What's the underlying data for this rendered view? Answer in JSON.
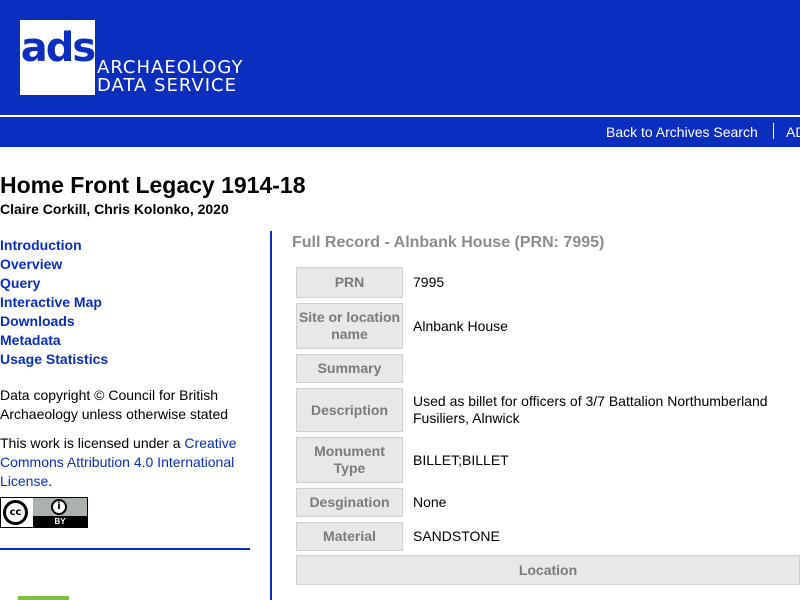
{
  "header": {
    "logo_letters": "ads",
    "logo_line1": "ARCHAEOLOGY",
    "logo_line2": "DATA SERVICE",
    "nav": {
      "back_link": "Back to Archives Search",
      "ads_link": "AD"
    }
  },
  "page": {
    "title": "Home Front Legacy 1914-18",
    "authors": "Claire Corkill, Chris Kolonko, 2020"
  },
  "sidebar": {
    "links": [
      "Introduction",
      "Overview",
      "Query",
      "Interactive Map",
      "Downloads",
      "Metadata",
      "Usage Statistics"
    ],
    "copyright": "Data copyright © Council for British Archaeology unless otherwise stated",
    "license_prefix": "This work is licensed under a ",
    "license_link": "Creative Commons Attribution 4.0 International License",
    "license_suffix": ".",
    "cc_badge": {
      "cc": "cc",
      "by": "BY",
      "person_icon": "i"
    }
  },
  "record": {
    "title": "Full Record - Alnbank House (PRN: 7995)",
    "rows": [
      {
        "label": "PRN",
        "value": "7995"
      },
      {
        "label": "Site or location name",
        "value": "Alnbank House"
      },
      {
        "label": "Summary",
        "value": ""
      },
      {
        "label": "Description",
        "value": "Used as billet for officers of 3/7 Battalion Northumberland Fusiliers, Alnwick"
      },
      {
        "label": "Monument Type",
        "value": "BILLET;BILLET"
      },
      {
        "label": "Desgination",
        "value": "None"
      },
      {
        "label": "Material",
        "value": "SANDSTONE"
      }
    ],
    "location_header": "Location"
  },
  "colors": {
    "brand_blue": "#0a2ebd",
    "label_grey": "#7a7a7a",
    "cell_bg": "#e8e8e8",
    "accent_green": "#7cc142"
  }
}
